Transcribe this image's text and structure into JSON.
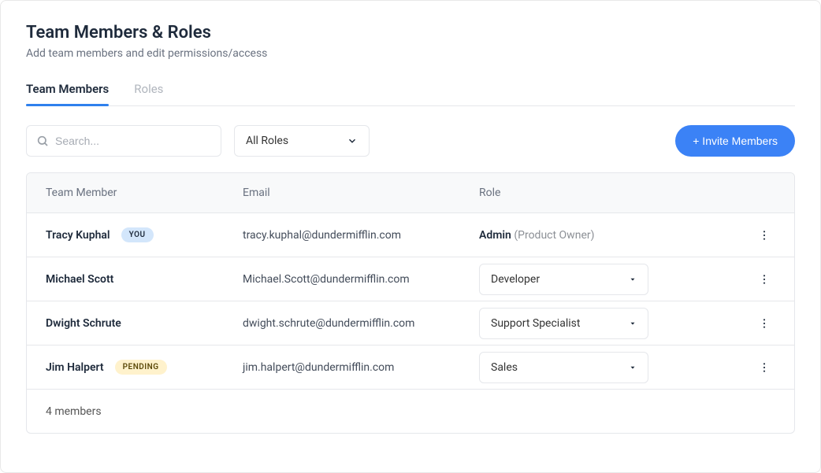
{
  "header": {
    "title": "Team Members & Roles",
    "subtitle": "Add team members and edit permissions/access"
  },
  "tabs": [
    {
      "label": "Team Members",
      "active": true
    },
    {
      "label": "Roles",
      "active": false
    }
  ],
  "search": {
    "placeholder": "Search..."
  },
  "roleFilter": {
    "selected": "All Roles"
  },
  "inviteButton": "+ Invite Members",
  "columns": {
    "name": "Team Member",
    "email": "Email",
    "role": "Role"
  },
  "badges": {
    "you": "YOU",
    "pending": "PENDING"
  },
  "members": [
    {
      "name": "Tracy Kuphal",
      "email": "tracy.kuphal@dundermifflin.com",
      "roleLabel": "Admin",
      "roleDetail": "(Product Owner)",
      "badge": "you",
      "roleEditable": false
    },
    {
      "name": "Michael Scott",
      "email": "Michael.Scott@dundermifflin.com",
      "roleLabel": "Developer",
      "badge": null,
      "roleEditable": true
    },
    {
      "name": "Dwight Schrute",
      "email": "dwight.schrute@dundermifflin.com",
      "roleLabel": "Support Specialist",
      "badge": null,
      "roleEditable": true
    },
    {
      "name": "Jim Halpert",
      "email": "jim.halpert@dundermifflin.com",
      "roleLabel": "Sales",
      "badge": "pending",
      "roleEditable": true
    }
  ],
  "footer": {
    "count": "4 members"
  }
}
